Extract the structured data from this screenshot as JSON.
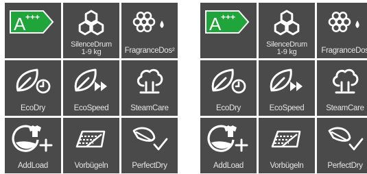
{
  "panels": [
    {
      "tiles": [
        {
          "label": "A+++",
          "icon": "energy-class-badge"
        },
        {
          "label": "SilenceDrum\n1-9 kg",
          "icon": "honeycomb-icon"
        },
        {
          "label": "FragranceDos²",
          "icon": "flower-drop-icon"
        },
        {
          "label": "EcoDry",
          "icon": "leaf-clock-icon"
        },
        {
          "label": "EcoSpeed",
          "icon": "leaf-fast-forward-icon"
        },
        {
          "label": "SteamCare",
          "icon": "steam-cloud-icon"
        },
        {
          "label": "AddLoad",
          "icon": "shirt-add-icon"
        },
        {
          "label": "Vorbügeln",
          "icon": "iron-sole-icon"
        },
        {
          "label": "PerfectDry",
          "icon": "feather-check-icon"
        }
      ]
    },
    {
      "tiles": [
        {
          "label": "A+++",
          "icon": "energy-class-badge"
        },
        {
          "label": "SilenceDrum\n1-9 kg",
          "icon": "honeycomb-icon"
        },
        {
          "label": "FragranceDos",
          "icon": "flower-drop-icon"
        },
        {
          "label": "EcoDry",
          "icon": "leaf-clock-icon"
        },
        {
          "label": "EcoSpeed",
          "icon": "leaf-fast-forward-icon"
        },
        {
          "label": "SteamCare",
          "icon": "steam-cloud-icon"
        },
        {
          "label": "AddLoad",
          "icon": "shirt-add-icon"
        },
        {
          "label": "Vorbügeln",
          "icon": "iron-sole-icon"
        },
        {
          "label": "PerfectDry",
          "icon": "feather-check-icon"
        }
      ]
    }
  ],
  "energy_badge": {
    "class": "A",
    "plus": "+++"
  },
  "colors": {
    "tile": "#4a4a4a",
    "energy_green": "#1fa53a",
    "icon": "#ffffff"
  }
}
